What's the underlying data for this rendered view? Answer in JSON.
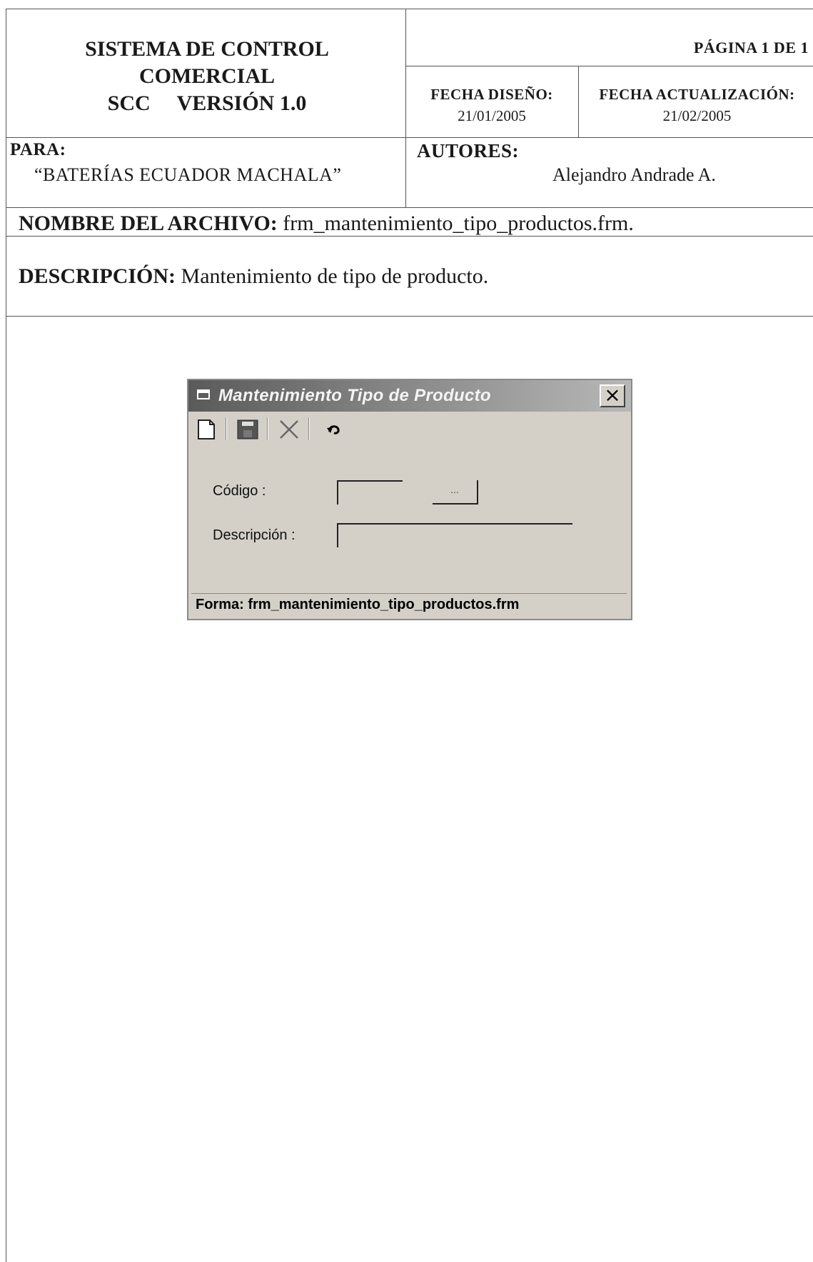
{
  "header": {
    "system_line1": "SISTEMA DE CONTROL",
    "system_line2": "COMERCIAL",
    "system_line3": "SCC     VERSIÓN 1.0",
    "page": "PÁGINA 1 DE 1",
    "design_date_label": "FECHA DISEÑO:",
    "design_date": "21/01/2005",
    "update_date_label": "FECHA ACTUALIZACIÓN:",
    "update_date": "21/02/2005",
    "for_label": "PARA:",
    "for_value": "“BATERÍAS ECUADOR MACHALA”",
    "authors_label": "AUTORES:",
    "authors_value": "Alejandro Andrade A.",
    "filename_label": "NOMBRE DEL ARCHIVO:",
    "filename_value": "frm_mantenimiento_tipo_productos.frm.",
    "description_label": "DESCRIPCIÓN:",
    "description_value": "Mantenimiento de tipo de producto."
  },
  "dialog": {
    "title": "Mantenimiento Tipo de Producto",
    "toolbar": [
      "new-icon",
      "save-icon",
      "delete-icon",
      "undo-icon"
    ],
    "code_label": "Código :",
    "code_value": "",
    "lookup_label": "...",
    "description_label": "Descripción :",
    "description_value": "",
    "status_text": "Forma: frm_mantenimiento_tipo_productos.frm"
  }
}
